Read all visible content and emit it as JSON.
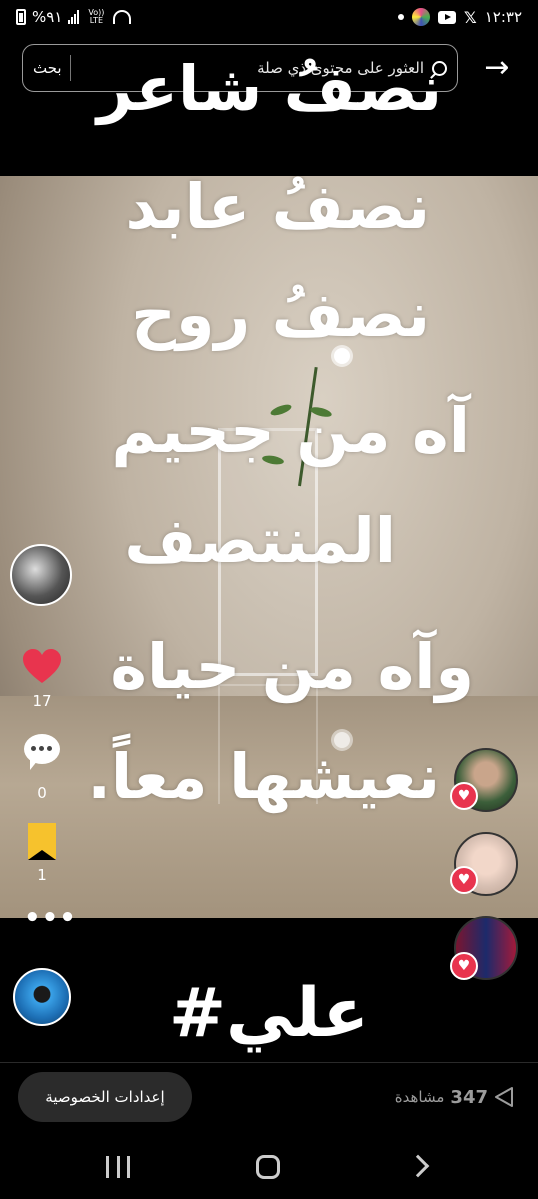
{
  "status_bar": {
    "time": "١٢:٣٢",
    "battery": "%٩١",
    "lte_label": "Vo)) LTE"
  },
  "search": {
    "text": "العثور على محتوى ذي صلة",
    "button_label": "بحث"
  },
  "poem_lines": [
    "نصفُ شاعر",
    "نصفُ عابد",
    "نصفُ روح",
    "آه من جحيم",
    "المنتصف",
    "وآه من حياة",
    "نعيشها معاً."
  ],
  "hashtag": "#علي",
  "actions": {
    "likes": "17",
    "comments": "0",
    "saves": "1"
  },
  "bottom": {
    "privacy_button": "إعدادات الخصوصية",
    "views_count": "347",
    "views_label": "مشاهدة"
  },
  "colors": {
    "like": "#e8344e",
    "save": "#f6c22d",
    "background": "#000000"
  }
}
